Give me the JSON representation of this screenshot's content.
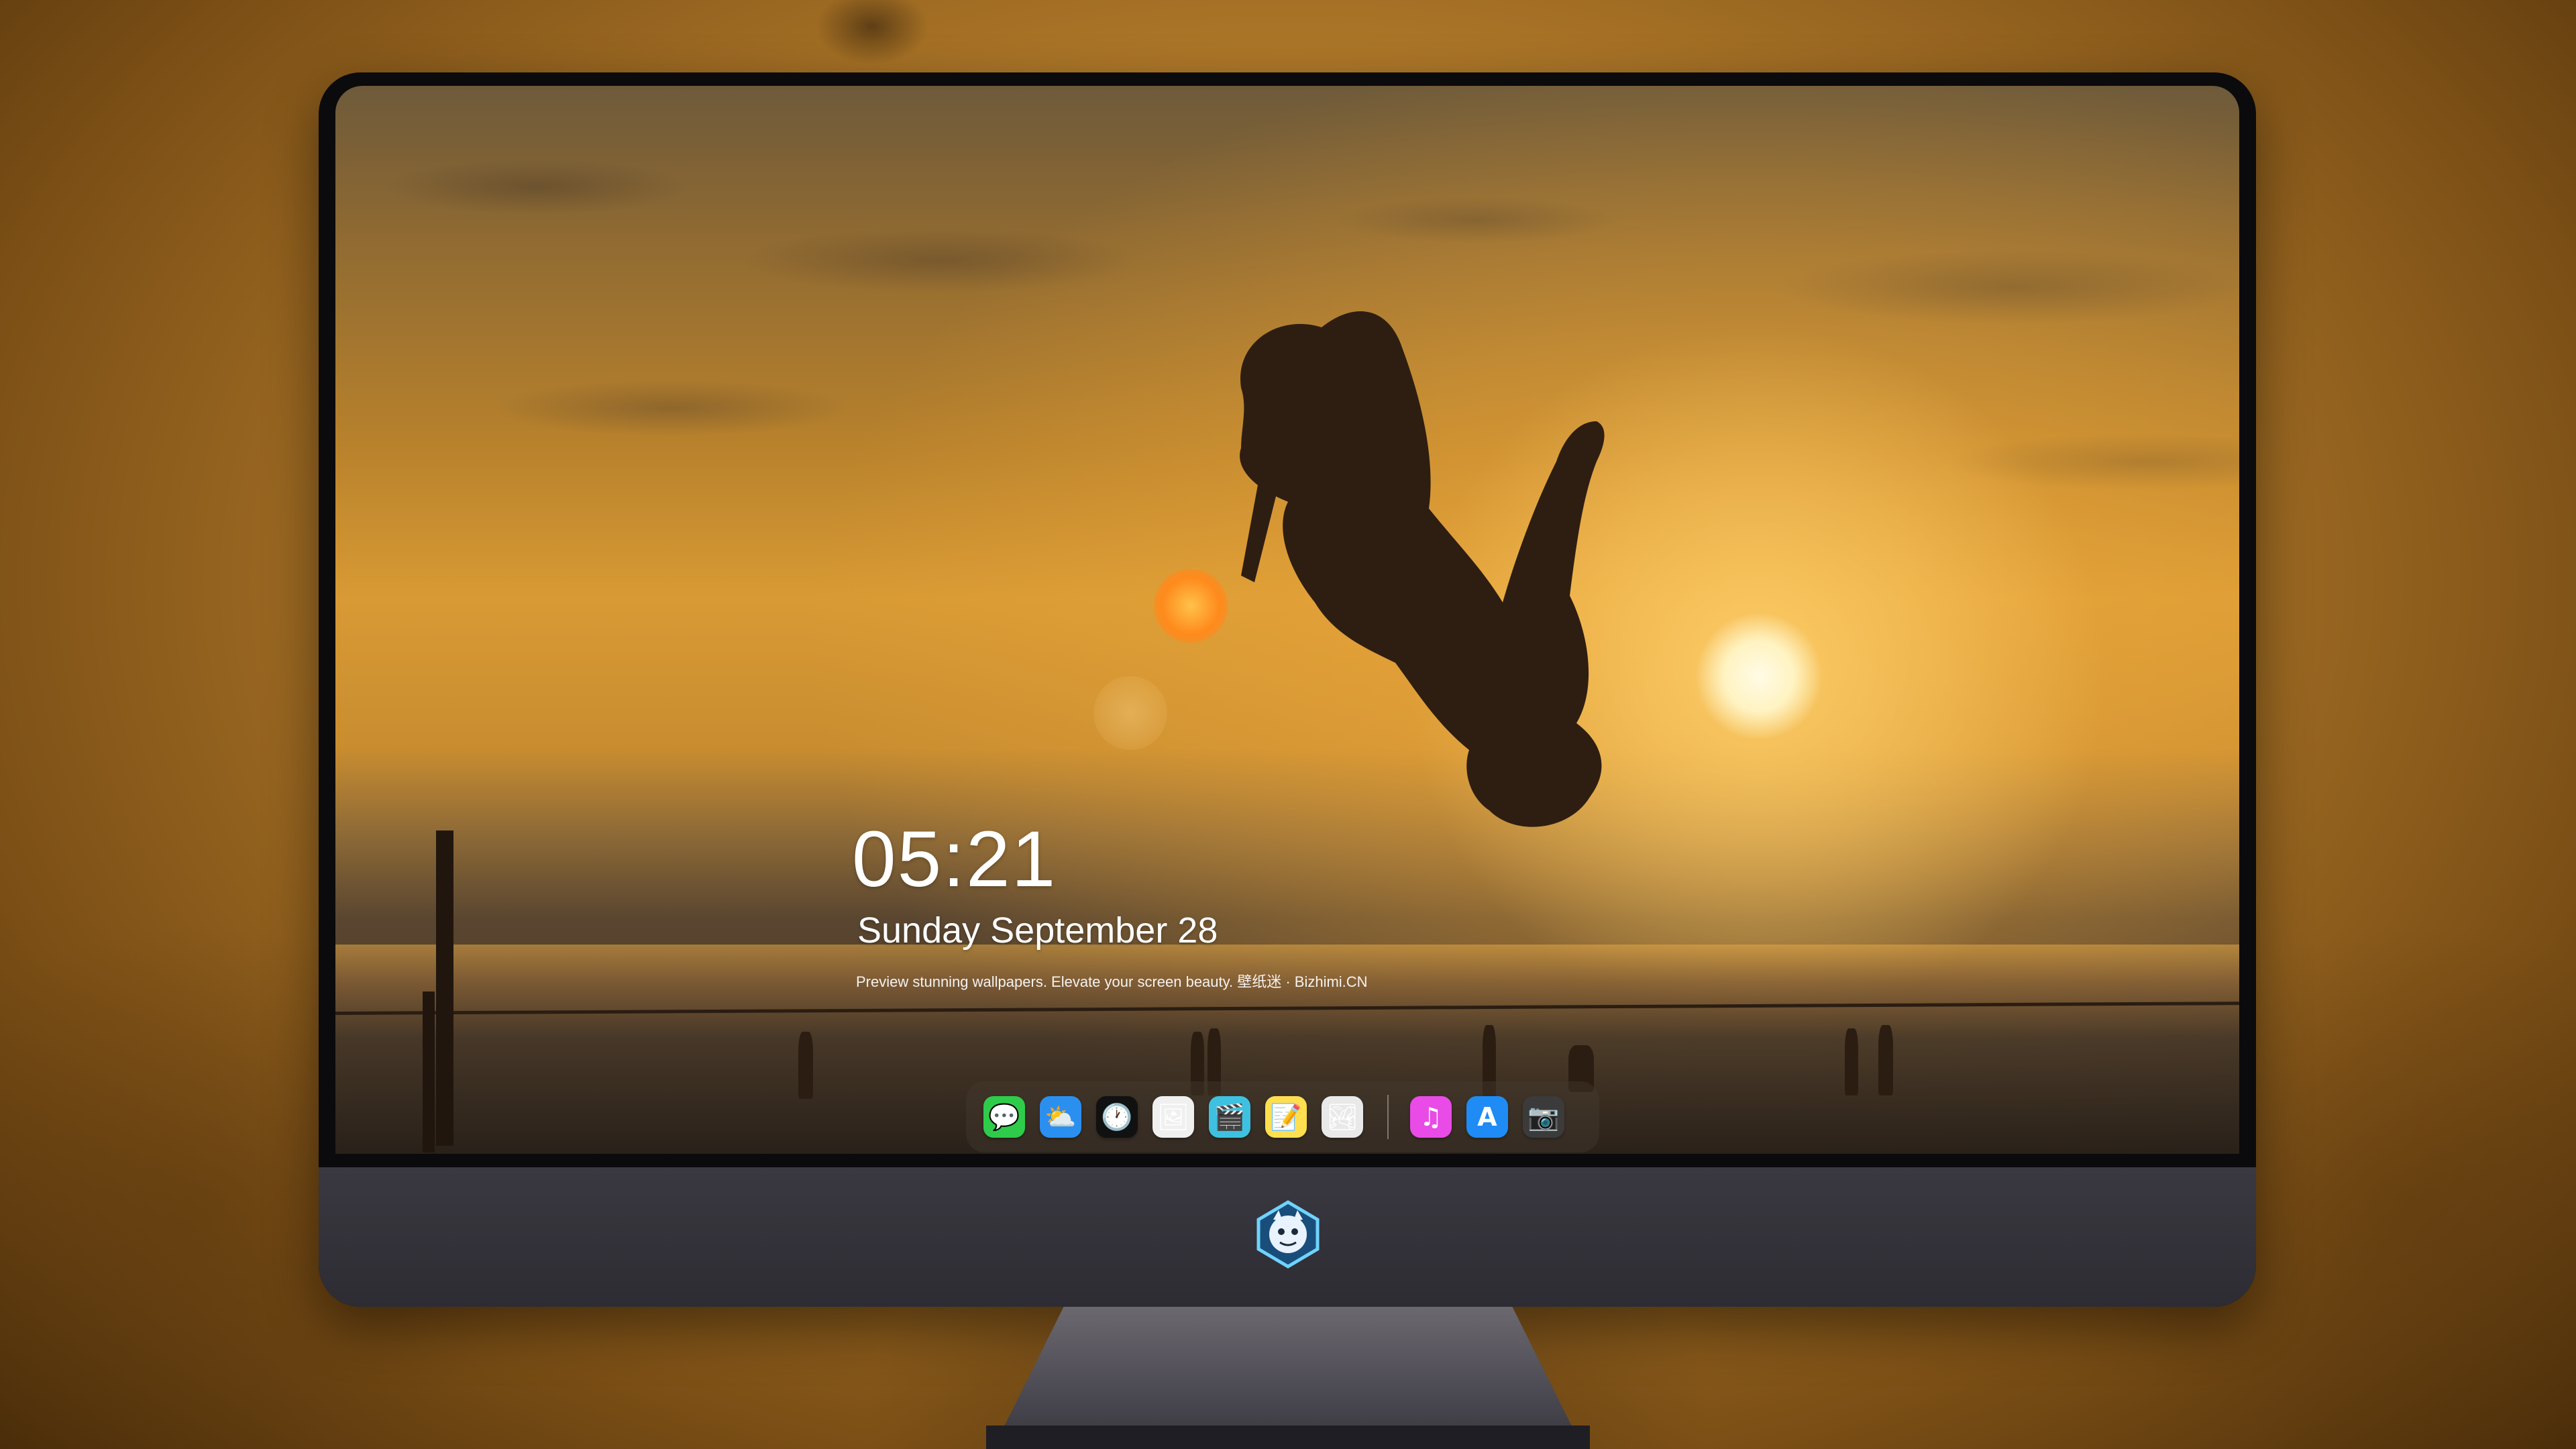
{
  "lockscreen": {
    "time": "05:21",
    "date": "Sunday September  28",
    "tagline": "Preview stunning wallpapers. Elevate your screen beauty. 壁纸迷 · Bizhimi.CN"
  },
  "dock": {
    "apps": [
      {
        "name": "Messages",
        "icon": "messages-icon",
        "color": "#2ecc4a",
        "glyph": "💬"
      },
      {
        "name": "Weather",
        "icon": "weather-icon",
        "color": "#2b8ff0",
        "glyph": "⛅"
      },
      {
        "name": "Clock",
        "icon": "clock-icon",
        "color": "#111111",
        "glyph": "🕐"
      },
      {
        "name": "Preview",
        "icon": "preview-icon",
        "color": "#f0f0f0",
        "glyph": "🖼"
      },
      {
        "name": "Claquette",
        "icon": "clapper-icon",
        "color": "#3ec1e0",
        "glyph": "🎬"
      },
      {
        "name": "Notes",
        "icon": "notes-icon",
        "color": "#ffdf50",
        "glyph": "📝"
      },
      {
        "name": "Photo Booth",
        "icon": "photo-booth-icon",
        "color": "#e9e9e9",
        "glyph": "🏞"
      },
      {
        "name": "Music",
        "icon": "music-icon",
        "color": "#e84be6",
        "glyph": "♫"
      },
      {
        "name": "App Store",
        "icon": "app-store-icon",
        "color": "#1e8cf4",
        "glyph": "A"
      },
      {
        "name": "Screenshot",
        "icon": "camera-icon",
        "color": "#3b3b3b",
        "glyph": "📷"
      }
    ]
  },
  "monitor": {
    "logo": "bizhimi-mascot-logo"
  }
}
